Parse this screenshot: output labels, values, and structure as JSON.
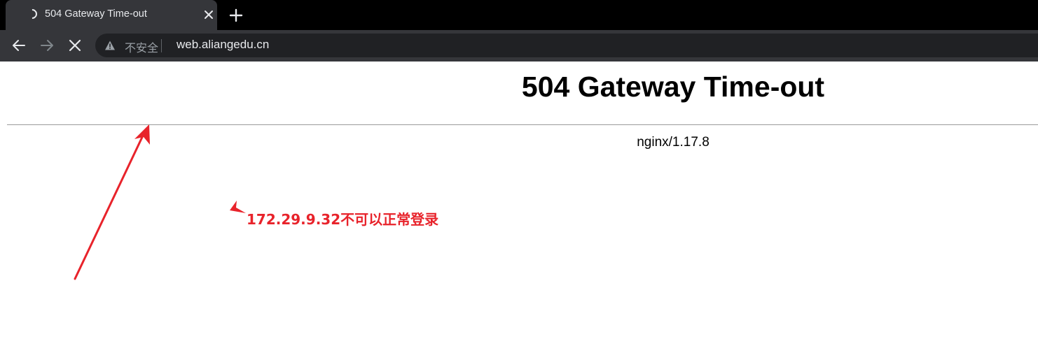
{
  "browser": {
    "tab": {
      "title": "504 Gateway Time-out",
      "loading_icon": "spinner-icon",
      "close_icon": "close-icon"
    },
    "new_tab_icon": "plus-icon",
    "toolbar": {
      "back_icon": "back-arrow-icon",
      "forward_icon": "forward-arrow-icon",
      "stop_icon": "stop-icon"
    },
    "omnibox": {
      "security_icon": "warning-icon",
      "security_label": "不安全",
      "url": "web.aliangedu.cn"
    }
  },
  "page": {
    "title": "504 Gateway Time-out",
    "server": "nginx/1.17.8"
  },
  "annotation": {
    "note": "172.29.9.32不可以正常登录",
    "color": "#e8232b"
  },
  "colors": {
    "tabstrip": "#000000",
    "toolbar": "#35363a",
    "omnibox": "#202124",
    "text_light": "#e8eaed",
    "text_muted": "#9aa0a6"
  }
}
